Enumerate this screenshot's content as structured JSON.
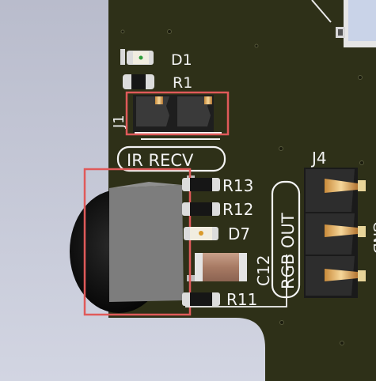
{
  "designators": {
    "d1": "D1",
    "r1": "R1",
    "j1": "J1",
    "r13": "R13",
    "r12": "R12",
    "d7": "D7",
    "c12": "C12",
    "r11": "R11",
    "j4": "J4"
  },
  "silkscreen": {
    "ir_recv": "IR RECV",
    "rgb_out": "RGB OUT",
    "header_side_label": "GND"
  },
  "colors": {
    "board": "#2e3018",
    "silk": "#f3f3f3",
    "highlight": "#e05a5a",
    "background": "#c4c8d6"
  }
}
